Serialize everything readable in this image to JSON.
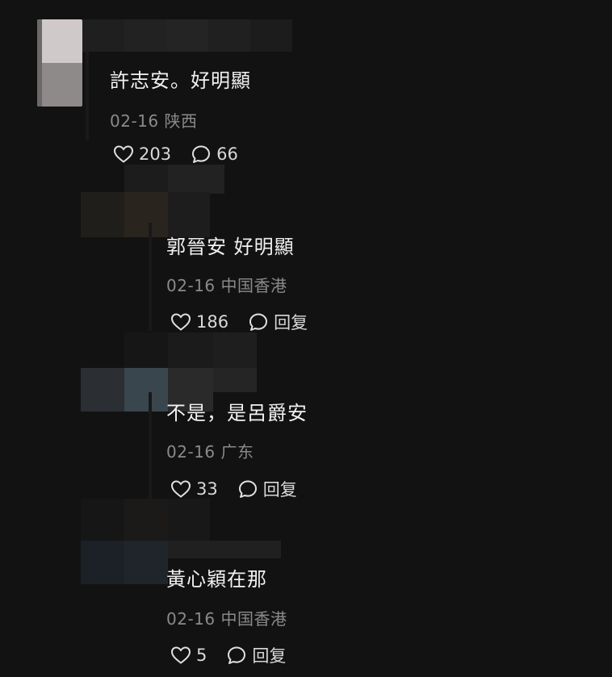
{
  "comments": [
    {
      "text": "許志安。好明顯",
      "date": "02-16",
      "location": "陕西",
      "likes": "203",
      "reply_label": "66"
    },
    {
      "text": "郭晉安 好明顯",
      "date": "02-16",
      "location": "中国香港",
      "likes": "186",
      "reply_label": "回复"
    },
    {
      "text": "不是，是呂爵安",
      "date": "02-16",
      "location": "广东",
      "likes": "33",
      "reply_label": "回复"
    },
    {
      "text": "黃心穎在那",
      "date": "02-16",
      "location": "中国香港",
      "likes": "5",
      "reply_label": "回复"
    }
  ],
  "icons": {
    "like": "heart-outline-icon",
    "reply": "speech-bubble-icon"
  },
  "colors": {
    "background": "#121212",
    "text": "#f1f1f1",
    "meta": "#8a8a8a"
  }
}
